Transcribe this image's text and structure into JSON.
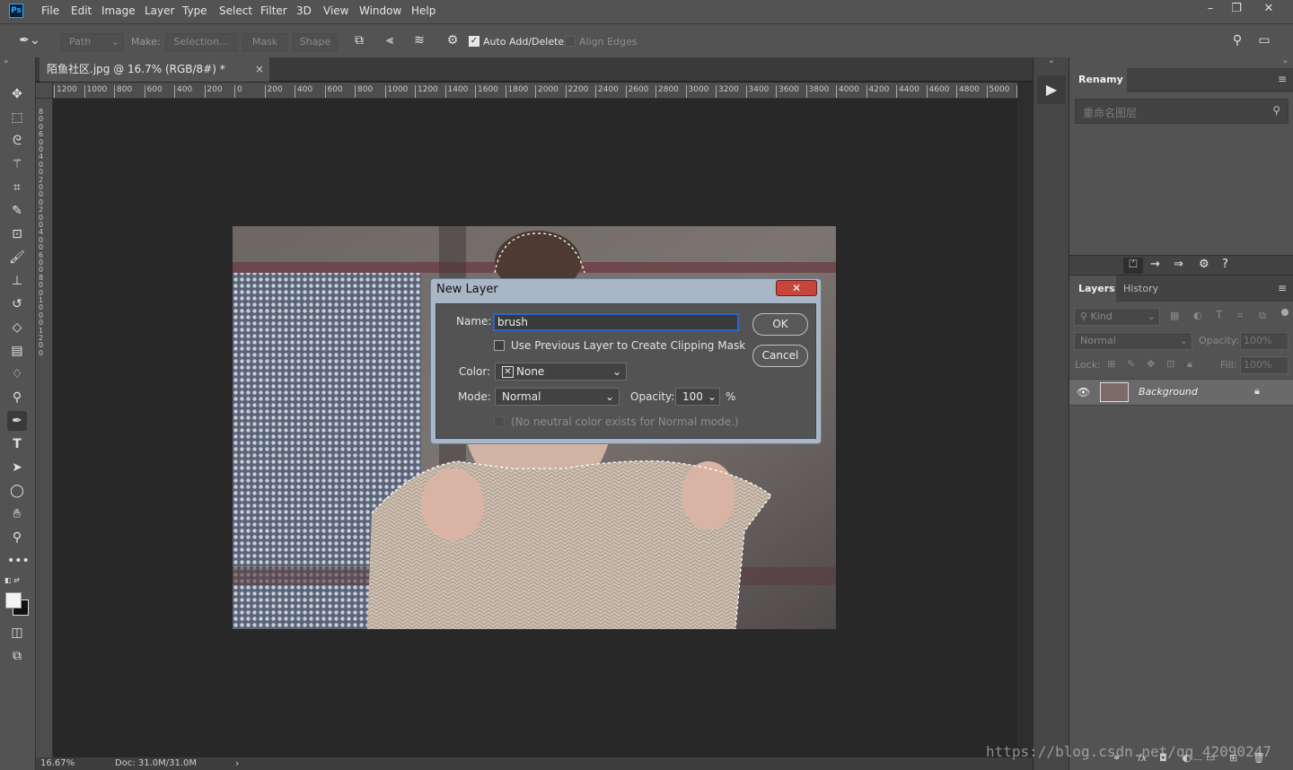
{
  "app": {
    "logo": "Ps"
  },
  "menu": [
    "File",
    "Edit",
    "Image",
    "Layer",
    "Type",
    "Select",
    "Filter",
    "3D",
    "View",
    "Window",
    "Help"
  ],
  "window_controls": {
    "minimize": "–",
    "restore": "❐",
    "close": "✕"
  },
  "options_bar": {
    "mode": "Path",
    "make_label": "Make:",
    "selection": "Selection...",
    "mask": "Mask",
    "shape": "Shape",
    "auto_add_delete": "Auto Add/Delete",
    "auto_add_delete_checked": true,
    "align_edges": "Align Edges"
  },
  "document": {
    "tab_title": "陌鱼社区.jpg @ 16.7% (RGB/8#) *",
    "close": "×",
    "zoom": "16.67%",
    "doc_info": "Doc: 31.0M/31.0M",
    "ruler_top": [
      "1200",
      "1000",
      "800",
      "600",
      "400",
      "200",
      "0",
      "200",
      "400",
      "600",
      "800",
      "1000",
      "1200",
      "1400",
      "1600",
      "1800",
      "2000",
      "2200",
      "2400",
      "2600",
      "2800",
      "3000",
      "3200",
      "3400",
      "3600",
      "3800",
      "4000",
      "4200",
      "4400",
      "4600",
      "4800",
      "5000",
      "5"
    ],
    "ruler_left": [
      "8",
      "0",
      "0",
      "6",
      "0",
      "0",
      "4",
      "0",
      "0",
      "2",
      "0",
      "0",
      "0",
      "2",
      "0",
      "0",
      "4",
      "0",
      "0",
      "6",
      "0",
      "0",
      "8",
      "0",
      "0",
      "1",
      "0",
      "0",
      "0",
      "1",
      "2",
      "0",
      "0"
    ]
  },
  "tools": [
    "move-tool",
    "marquee-tool",
    "lasso-tool",
    "magic-wand-tool",
    "crop-tool",
    "eyedropper-tool",
    "frame-tool",
    "brush-tool",
    "stamp-tool",
    "history-brush-tool",
    "eraser-tool",
    "gradient-tool",
    "blur-tool",
    "dodge-tool",
    "pen-tool",
    "type-tool",
    "path-select-tool",
    "ellipse-tool",
    "hand-tool",
    "zoom-tool",
    "more-tool"
  ],
  "dialog": {
    "title": "New Layer",
    "close": "✕",
    "name_label": "Name:",
    "name_value": "brush",
    "clipping_label": "Use Previous Layer to Create Clipping Mask",
    "color_label": "Color:",
    "color_value": "None",
    "mode_label": "Mode:",
    "mode_value": "Normal",
    "opacity_label": "Opacity:",
    "opacity_value": "100",
    "opacity_unit": "%",
    "neutral_label": "(No neutral color exists for Normal mode.)",
    "ok": "OK",
    "cancel": "Cancel"
  },
  "renamy_panel": {
    "tab": "Renamy",
    "search_placeholder": "重命名图层"
  },
  "layers_panel": {
    "tabs": [
      "Layers",
      "History"
    ],
    "kind_label": "Kind",
    "blend_mode": "Normal",
    "opacity_label": "Opacity:",
    "opacity_value": "100%",
    "lock_label": "Lock:",
    "fill_label": "Fill:",
    "fill_value": "100%",
    "layers": [
      {
        "name": "Background",
        "visible": true,
        "locked": true
      }
    ]
  },
  "watermark": "https://blog.csdn.net/qq_42090247",
  "colors": {
    "accent": "#31a8ff",
    "dialog_frame": "#a9b6c6",
    "close_red": "#c7453a"
  }
}
